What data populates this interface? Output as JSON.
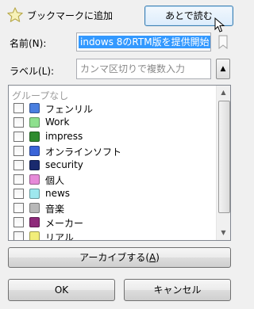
{
  "dialog": {
    "title": "ブックマークに追加",
    "later_button": "あとで読む"
  },
  "name_field": {
    "label": "名前(N):",
    "value": "indows 8のRTM版を提供開始"
  },
  "label_field": {
    "label": "ラベル(L):",
    "placeholder": "カンマ区切りで複数入力",
    "toggle": "▲"
  },
  "label_list": {
    "header": "グループなし",
    "items": [
      {
        "label": "フェンリル",
        "color": "#4a7fe0"
      },
      {
        "label": "Work",
        "color": "#8ee08e"
      },
      {
        "label": "impress",
        "color": "#2e8b2e"
      },
      {
        "label": "オンラインソフト",
        "color": "#3a64d8"
      },
      {
        "label": "security",
        "color": "#1a2a6e"
      },
      {
        "label": "個人",
        "color": "#e68ad8"
      },
      {
        "label": "news",
        "color": "#9ee8ee"
      },
      {
        "label": "音楽",
        "color": "#b8b8b8"
      },
      {
        "label": "メーカー",
        "color": "#8e2a7a"
      },
      {
        "label": "リアル",
        "color": "#f2ee7a"
      }
    ]
  },
  "buttons": {
    "archive_main": "アーカイブする(",
    "archive_key": "A",
    "archive_end": ")",
    "ok": "OK",
    "cancel": "キャンセル"
  },
  "icons": {
    "star": "star-icon",
    "bookmark": "bookmark-icon",
    "cursor": "mouse-cursor-icon"
  }
}
